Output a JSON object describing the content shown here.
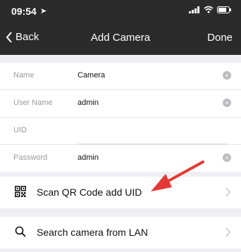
{
  "status": {
    "time": "09:54"
  },
  "nav": {
    "back": "Back",
    "title": "Add Camera",
    "done": "Done"
  },
  "form": {
    "fields": [
      {
        "label": "Name",
        "value": "Camera"
      },
      {
        "label": "User Name",
        "value": "admin"
      },
      {
        "label": "UID",
        "value": ""
      },
      {
        "label": "Password",
        "value": "admin"
      }
    ]
  },
  "actions": [
    {
      "label": "Scan QR Code add UID",
      "icon": "qr-code-icon"
    },
    {
      "label": "Search camera from LAN",
      "icon": "search-icon"
    }
  ],
  "colors": {
    "header": "#2b2b2b",
    "background": "#efeff4",
    "arrow": "#e53935"
  }
}
